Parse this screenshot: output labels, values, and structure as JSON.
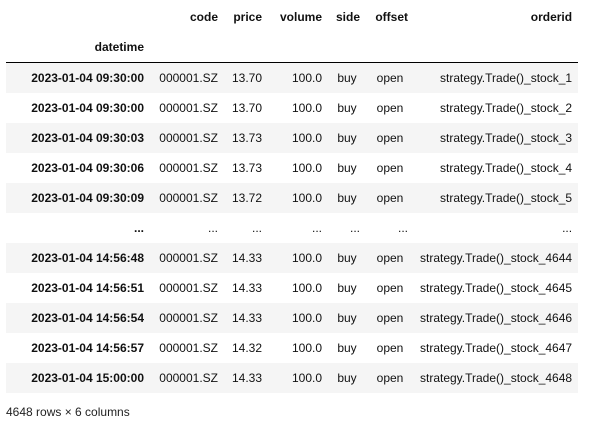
{
  "table": {
    "columns": [
      "code",
      "price",
      "volume",
      "side",
      "offset",
      "orderid"
    ],
    "index_name": "datetime",
    "rows": [
      {
        "index": "2023-01-04 09:30:00",
        "cells": [
          "000001.SZ",
          "13.70",
          "100.0",
          "buy",
          "open",
          "strategy.Trade()_stock_1"
        ]
      },
      {
        "index": "2023-01-04 09:30:00",
        "cells": [
          "000001.SZ",
          "13.70",
          "100.0",
          "buy",
          "open",
          "strategy.Trade()_stock_2"
        ]
      },
      {
        "index": "2023-01-04 09:30:03",
        "cells": [
          "000001.SZ",
          "13.73",
          "100.0",
          "buy",
          "open",
          "strategy.Trade()_stock_3"
        ]
      },
      {
        "index": "2023-01-04 09:30:06",
        "cells": [
          "000001.SZ",
          "13.73",
          "100.0",
          "buy",
          "open",
          "strategy.Trade()_stock_4"
        ]
      },
      {
        "index": "2023-01-04 09:30:09",
        "cells": [
          "000001.SZ",
          "13.72",
          "100.0",
          "buy",
          "open",
          "strategy.Trade()_stock_5"
        ]
      },
      {
        "index": "...",
        "cells": [
          "...",
          "...",
          "...",
          "...",
          "...",
          "..."
        ]
      },
      {
        "index": "2023-01-04 14:56:48",
        "cells": [
          "000001.SZ",
          "14.33",
          "100.0",
          "buy",
          "open",
          "strategy.Trade()_stock_4644"
        ]
      },
      {
        "index": "2023-01-04 14:56:51",
        "cells": [
          "000001.SZ",
          "14.33",
          "100.0",
          "buy",
          "open",
          "strategy.Trade()_stock_4645"
        ]
      },
      {
        "index": "2023-01-04 14:56:54",
        "cells": [
          "000001.SZ",
          "14.33",
          "100.0",
          "buy",
          "open",
          "strategy.Trade()_stock_4646"
        ]
      },
      {
        "index": "2023-01-04 14:56:57",
        "cells": [
          "000001.SZ",
          "14.32",
          "100.0",
          "buy",
          "open",
          "strategy.Trade()_stock_4647"
        ]
      },
      {
        "index": "2023-01-04 15:00:00",
        "cells": [
          "000001.SZ",
          "14.33",
          "100.0",
          "buy",
          "open",
          "strategy.Trade()_stock_4648"
        ]
      }
    ]
  },
  "footer": {
    "shape_text": "4648 rows × 6 columns"
  }
}
